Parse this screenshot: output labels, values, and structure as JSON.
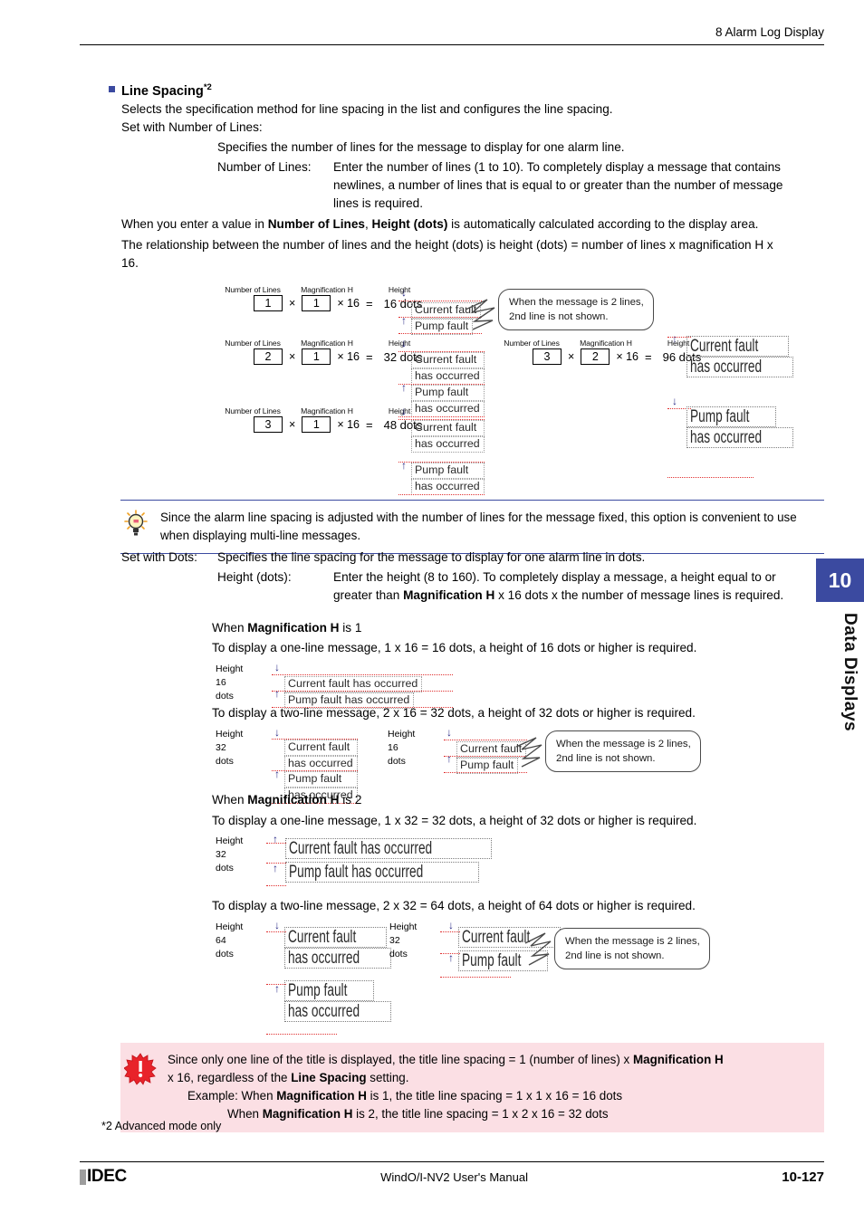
{
  "header": {
    "running_head": "8 Alarm Log Display"
  },
  "section": {
    "title": "Line Spacing",
    "title_footnote": "*2",
    "intro": "Selects the specification method for line spacing in the list and configures the line spacing.",
    "set_with_number_label": "Set with Number of Lines:",
    "specifies_lines": "Specifies the number of lines for the message to display for one alarm line.",
    "number_of_lines_label": "Number of Lines:",
    "number_of_lines_text": "Enter the number of lines (1 to 10). To completely display a message that contains newlines, a number of lines that is equal to or greater than the number of message lines is required.",
    "auto_calc_pre": "When you enter a value in ",
    "auto_calc_b1": "Number of Lines",
    "auto_calc_mid": ", ",
    "auto_calc_b2": "Height (dots)",
    "auto_calc_post": " is automatically calculated according to the display area.",
    "relationship_text": "The relationship between the number of lines and the height (dots) is height (dots) = number of lines x magnification H x 16."
  },
  "calc_headers": {
    "number_of_lines": "Number of Lines",
    "magnification_h": "Magnification H",
    "height": "Height"
  },
  "calc_rows": [
    {
      "lines": "1",
      "mag": "1",
      "mul": "× 16",
      "eq": "=",
      "result": "16 dots"
    },
    {
      "lines": "2",
      "mag": "1",
      "mul": "× 16",
      "eq": "=",
      "result": "32 dots"
    },
    {
      "lines": "3",
      "mag": "1",
      "mul": "× 16",
      "eq": "=",
      "result": "48 dots"
    },
    {
      "lines": "3",
      "mag": "2",
      "mul": "× 16",
      "eq": "=",
      "result": "96 dots"
    }
  ],
  "ops": {
    "times": "×"
  },
  "messages": {
    "current_fault": "Current fault",
    "pump_fault": "Pump fault",
    "has_occurred": "has occurred",
    "current_fault_has_occurred": "Current fault has occurred",
    "pump_fault_has_occurred": "Pump fault has occurred"
  },
  "callout": {
    "line1": "When the message is 2 lines,",
    "line2": "2nd line is not shown."
  },
  "tip": {
    "text": "Since the alarm line spacing is adjusted with the number of lines for the message fixed, this option is convenient to use when displaying multi-line messages.",
    "icon": "lightbulb-icon"
  },
  "set_with_dots": {
    "label": "Set with Dots:",
    "text": "Specifies the line spacing for the message to display for one alarm line in dots.",
    "height_label": "Height (dots):",
    "height_text_pre": "Enter the height (8 to 160). To completely display a message, a height equal to or greater than ",
    "height_text_b": "Magnification H",
    "height_text_post": " x 16 dots x the number of message lines is required."
  },
  "mag1": {
    "heading_pre": "When ",
    "heading_b": "Magnification H",
    "heading_post": " is 1",
    "one_line": "To display a one-line message, 1 x 16 = 16 dots, a height of 16 dots or higher is required.",
    "two_line": "To display a two-line message, 2 x 16 = 32 dots, a height of 32 dots or higher is required."
  },
  "mag2": {
    "heading_pre": "When ",
    "heading_b": "Magnification H",
    "heading_post": " is 2",
    "one_line": "To display a one-line message, 1 x 32 = 32 dots, a height of 32 dots or higher is required.",
    "two_line": "To display a two-line message, 2 x 32 = 64 dots, a height of 64 dots or higher is required."
  },
  "height_labels": {
    "caption": "Height",
    "h16": "16 dots",
    "h32": "32 dots",
    "h64": "64 dots"
  },
  "warning": {
    "icon": "warning-burst-icon",
    "l1_pre": "Since only one line of the title is displayed, the title line spacing = 1 (number of lines) x ",
    "l1_b": "Magnification H",
    "l2_pre": "x 16, regardless of the ",
    "l2_b": "Line Spacing",
    "l2_post": " setting.",
    "ex_label": "Example:",
    "ex1_pre": " When ",
    "ex1_b": "Magnification H",
    "ex1_post": " is 1, the title line spacing = 1 x 1 x 16 = 16 dots",
    "ex2_pre": "When ",
    "ex2_b": "Magnification H",
    "ex2_post": " is 2, the title line spacing = 1 x 2 x 16 = 32 dots"
  },
  "footnote": "*2  Advanced mode only",
  "side_tab": {
    "number": "10",
    "label": "Data Displays",
    "color": "#3b4aa0"
  },
  "footer": {
    "logo": "IDEC",
    "manual": "WindO/I-NV2 User's Manual",
    "page": "10-127"
  }
}
